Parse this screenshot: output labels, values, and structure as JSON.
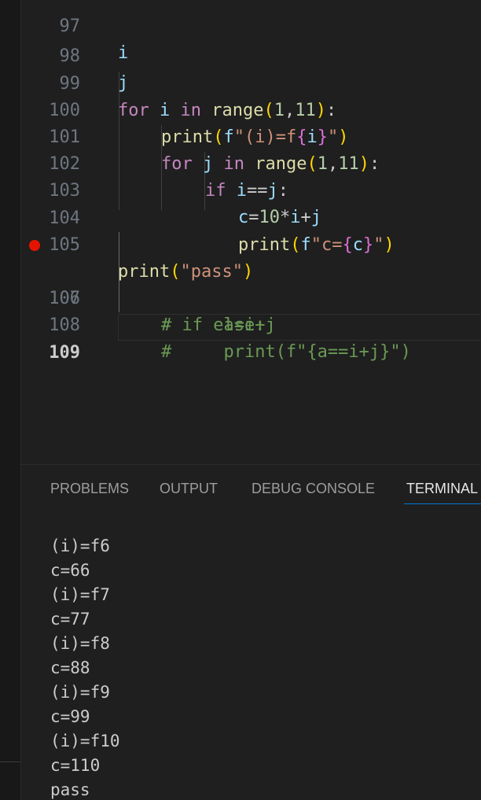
{
  "editor": {
    "lines": [
      {
        "number": "97",
        "code": "i"
      },
      {
        "number": "98",
        "code": "j"
      },
      {
        "number": "99",
        "code": "for i in range(1,11):"
      },
      {
        "number": "100",
        "code": "print(f\"(i)=f{i}\")"
      },
      {
        "number": "101",
        "code": "for j in range(1,11):"
      },
      {
        "number": "102",
        "code": "if i==j:"
      },
      {
        "number": "103",
        "code": "c=10*i+j"
      },
      {
        "number": "104",
        "code": "print(f\"c={c}\")"
      },
      {
        "number": "105",
        "code": "print(\"pass\")"
      },
      {
        "number": "106",
        "code": "# if else:"
      },
      {
        "number": "107",
        "code": "#     a=i+j"
      },
      {
        "number": "108",
        "code": "#     print(f\"{a==i+j}\")"
      },
      {
        "number": "109",
        "code": ""
      }
    ],
    "breakpoint_line": "106",
    "active_line": "109"
  },
  "panel": {
    "tabs": [
      {
        "label": "PROBLEMS",
        "active": false
      },
      {
        "label": "OUTPUT",
        "active": false
      },
      {
        "label": "DEBUG CONSOLE",
        "active": false
      },
      {
        "label": "TERMINAL",
        "active": true
      }
    ],
    "terminal_output": [
      "(i)=f6",
      "c=66",
      "(i)=f7",
      "c=77",
      "(i)=f8",
      "c=88",
      "(i)=f9",
      "c=99",
      "(i)=f10",
      "c=110",
      "pass"
    ]
  },
  "colors": {
    "breakpoint": "#e51400",
    "keyword": "#c586c0",
    "function": "#dcdcaa",
    "string": "#ce9178",
    "comment": "#6a9955",
    "active_tab_underline": "#0078d4"
  }
}
